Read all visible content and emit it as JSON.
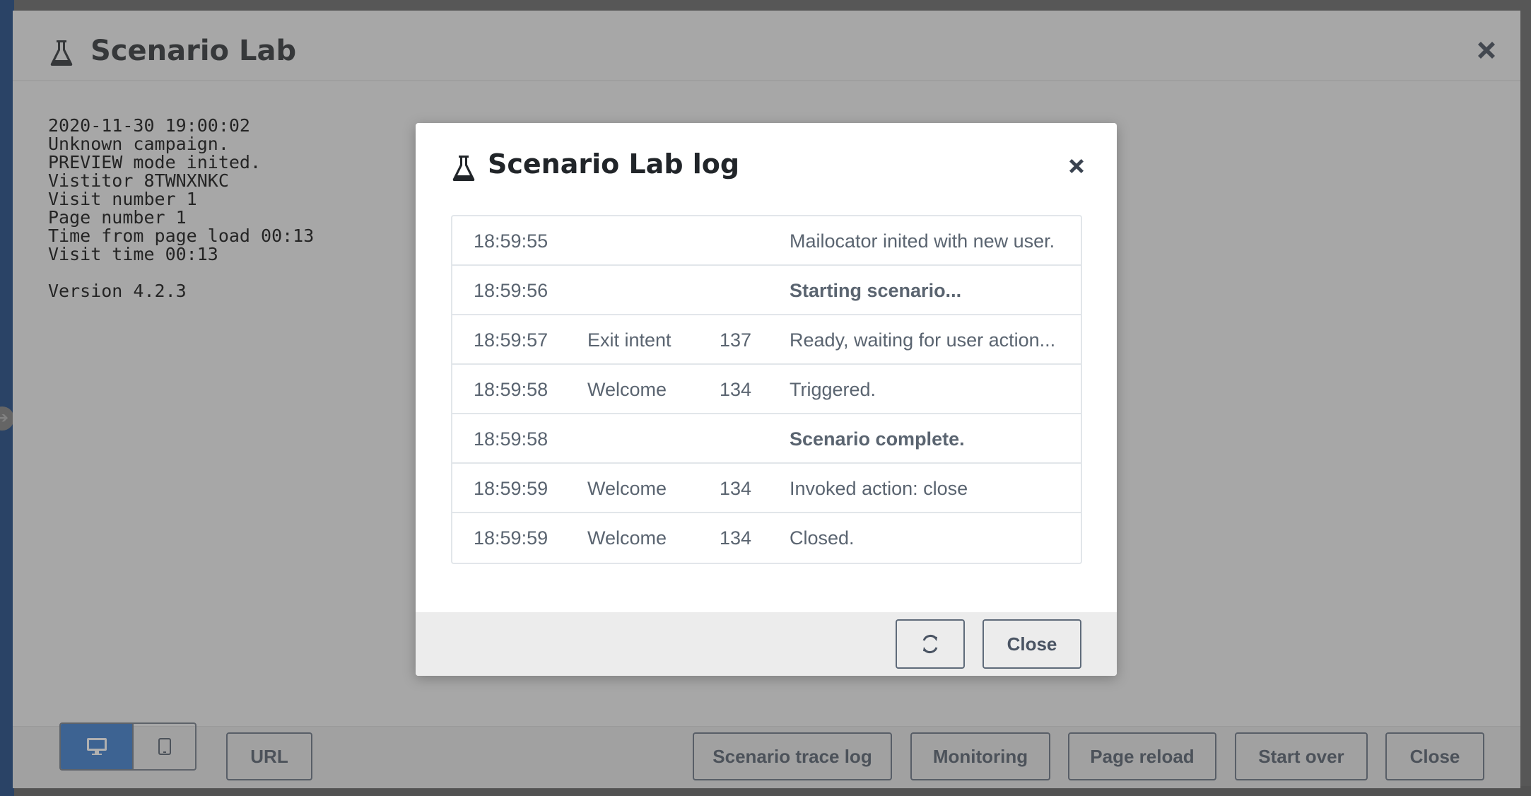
{
  "window": {
    "title": "Scenario Lab",
    "info_lines": [
      "2020-11-30 19:00:02",
      "Unknown campaign.",
      "PREVIEW mode inited.",
      "Vistitor 8TWNXNKC",
      "Visit number 1",
      "Page number 1",
      "Time from page load 00:13",
      "Visit time 00:13",
      "",
      "Version 4.2.3"
    ]
  },
  "toolbar": {
    "device_selected": "desktop",
    "url_label": "URL",
    "trace_log_label": "Scenario trace log",
    "monitoring_label": "Monitoring",
    "page_reload_label": "Page reload",
    "start_over_label": "Start over",
    "close_label": "Close"
  },
  "modal": {
    "title": "Scenario Lab log",
    "close_label": "Close",
    "rows": [
      {
        "time": "18:59:55",
        "name": "",
        "id": "",
        "message": "Mailocator inited with new user.",
        "bold": false
      },
      {
        "time": "18:59:56",
        "name": "",
        "id": "",
        "message": "Starting scenario...",
        "bold": true
      },
      {
        "time": "18:59:57",
        "name": "Exit intent",
        "id": "137",
        "message": "Ready, waiting for user action...",
        "bold": false
      },
      {
        "time": "18:59:58",
        "name": "Welcome",
        "id": "134",
        "message": "Triggered.",
        "bold": false
      },
      {
        "time": "18:59:58",
        "name": "",
        "id": "",
        "message": "Scenario complete.",
        "bold": true
      },
      {
        "time": "18:59:59",
        "name": "Welcome",
        "id": "134",
        "message": "Invoked action: close",
        "bold": false
      },
      {
        "time": "18:59:59",
        "name": "Welcome",
        "id": "134",
        "message": "Closed.",
        "bold": false
      }
    ]
  },
  "icons": {
    "title_icon": "flask-icon",
    "close_icon": "close-icon",
    "refresh_icon": "refresh-icon",
    "desktop_icon": "desktop-icon",
    "tablet_icon": "tablet-icon"
  },
  "colors": {
    "primary": "#2f73c9",
    "button_border": "#5f6b7a",
    "text_muted": "#5a6470"
  }
}
